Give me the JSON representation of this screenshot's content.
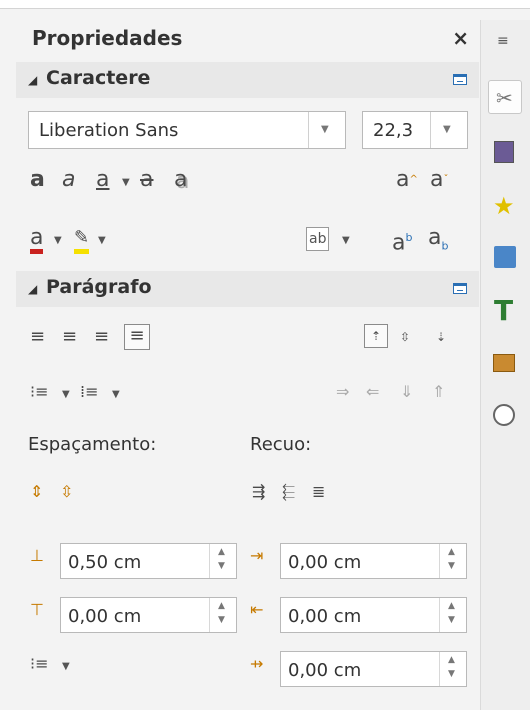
{
  "panel": {
    "title": "Propriedades",
    "close_glyph": "×"
  },
  "caractere": {
    "heading": "Caractere",
    "font_name": "Liberation Sans",
    "font_size": "22,3",
    "icons": [
      "bold-icon",
      "italic-icon",
      "underline-icon",
      "strikethrough-icon",
      "shadow-icon",
      "grow-font-icon",
      "shrink-font-icon",
      "font-color-icon",
      "highlight-color-icon",
      "spacing-icon",
      "superscript-icon",
      "subscript-icon"
    ]
  },
  "paragrafo": {
    "heading": "Parágrafo",
    "spacing_label": "Espaçamento:",
    "indent_label": "Recuo:",
    "above_spacing": "0,50 cm",
    "below_spacing": "0,00 cm",
    "before_indent": "0,00 cm",
    "after_indent": "0,00 cm",
    "first_line_indent": "0,00 cm"
  },
  "sidebar": {
    "items": [
      "properties-icon",
      "styles-icon",
      "gallery-icon",
      "navigator-icon",
      "page-icon",
      "manage-changes-icon",
      "compass-icon"
    ]
  },
  "colors": {
    "accent": "#2a6fb4",
    "font_color_bar": "#c9211e",
    "highlight_bar": "#f5e000"
  }
}
